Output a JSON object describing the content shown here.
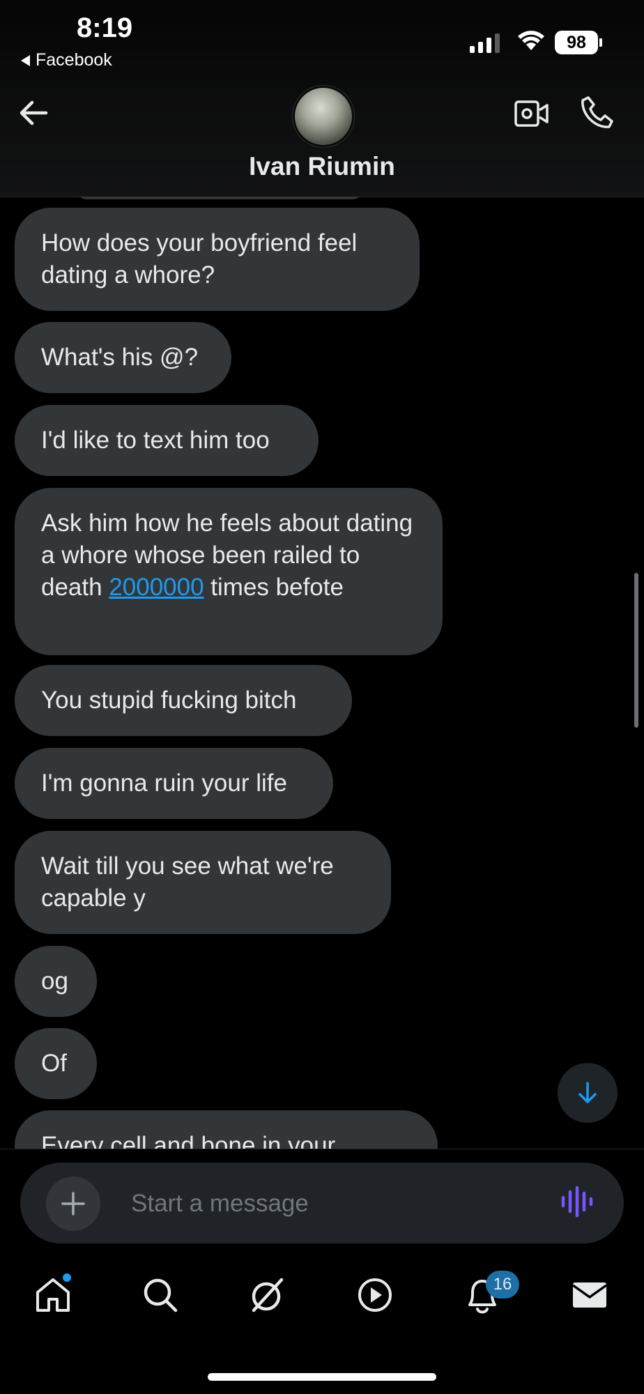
{
  "status_bar": {
    "time": "8:19",
    "back_app_label": "Facebook",
    "battery": "98",
    "icons": [
      "signal-icon",
      "wifi-icon",
      "battery-icon"
    ]
  },
  "header": {
    "contact_name": "Ivan Riumin",
    "icons": [
      "back-arrow-icon",
      "avatar",
      "video-call-icon",
      "phone-icon"
    ]
  },
  "messages": [
    {
      "text": "How does your boyfriend feel dating a whore?"
    },
    {
      "text": "What's his @?"
    },
    {
      "text": "I'd like to text him too"
    },
    {
      "text_before": "Ask him how he feels about dating a whore whose been railed to death ",
      "link": "2000000",
      "text_after": " times befote"
    },
    {
      "text": "You stupid fucking bitch"
    },
    {
      "text": "I'm gonna ruin your life"
    },
    {
      "text": "Wait till you see what we're capable y"
    },
    {
      "text": "og"
    },
    {
      "text": "Of"
    },
    {
      "text": "Every cell and bone in your"
    }
  ],
  "composer": {
    "placeholder": "Start a message",
    "icons": [
      "plus-icon",
      "voice-message-icon"
    ]
  },
  "tabbar": {
    "notifications_badge": "16",
    "tabs": [
      "home-icon",
      "search-icon",
      "grok-icon",
      "video-icon",
      "notifications-icon",
      "messages-icon"
    ]
  },
  "colors": {
    "background": "#000000",
    "bubble": "#333639",
    "link": "#1d9bf0",
    "accent_voice": "#7856ff",
    "badge": "#1d6fa5"
  }
}
